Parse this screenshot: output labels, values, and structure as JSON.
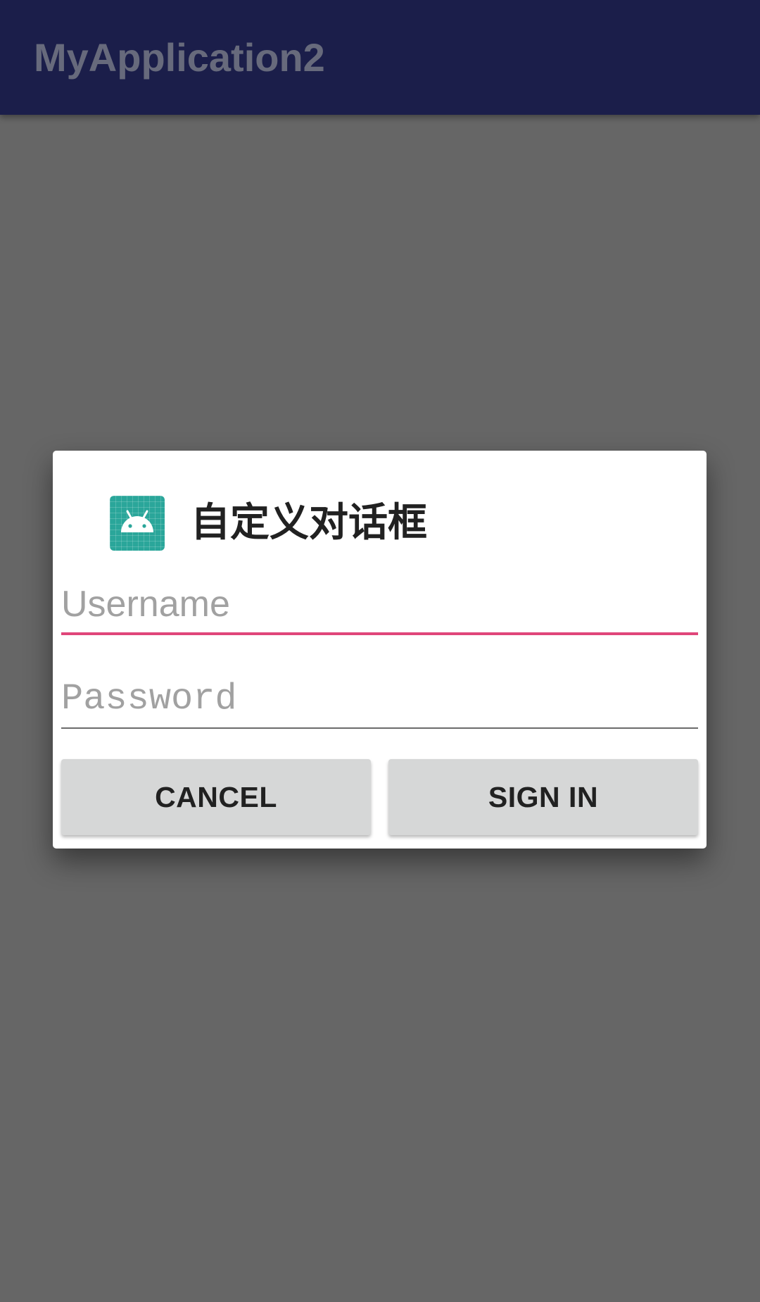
{
  "app_bar": {
    "title": "MyApplication2",
    "background": "#1b1e4a"
  },
  "dialog": {
    "icon": "android-app-icon",
    "icon_color": "#2aa69a",
    "title": "自定义对话框",
    "username": {
      "value": "",
      "placeholder": "Username",
      "focused": true,
      "accent": "#e0467a"
    },
    "password": {
      "value": "",
      "placeholder": "Password"
    },
    "buttons": {
      "cancel_label": "CANCEL",
      "signin_label": "SIGN IN"
    }
  },
  "scrim_color": "#666666"
}
